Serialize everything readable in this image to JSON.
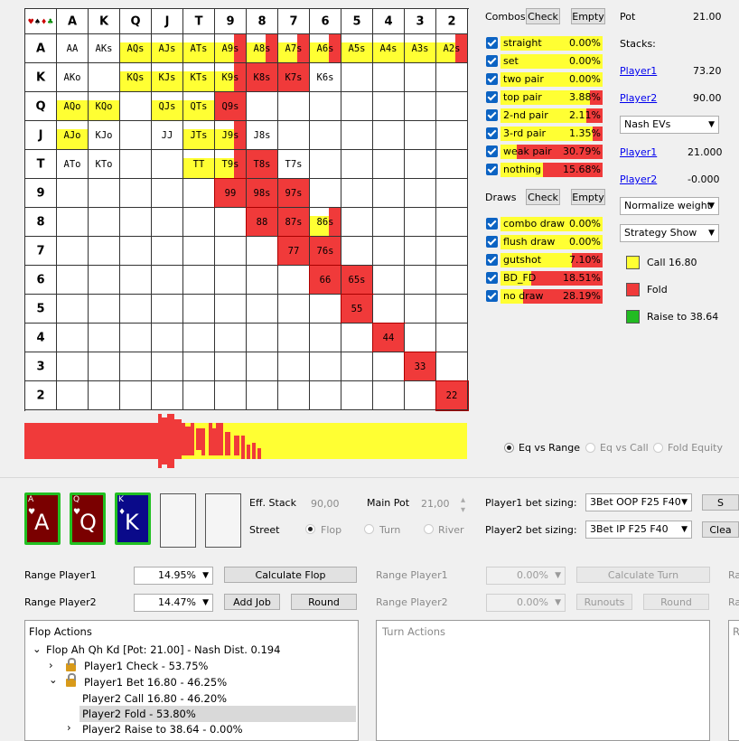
{
  "matrix": {
    "headers": [
      "A",
      "K",
      "Q",
      "J",
      "T",
      "9",
      "8",
      "7",
      "6",
      "5",
      "4",
      "3",
      "2"
    ],
    "corner_suits": [
      "♥",
      "♠",
      "♦",
      "♣"
    ],
    "cells": [
      {
        "r": 0,
        "c": 0,
        "label": "AA",
        "color": "none"
      },
      {
        "r": 0,
        "c": 1,
        "label": "AKs",
        "color": "none"
      },
      {
        "r": 0,
        "c": 2,
        "label": "AQs",
        "color": "yellow"
      },
      {
        "r": 0,
        "c": 3,
        "label": "AJs",
        "color": "yellow"
      },
      {
        "r": 0,
        "c": 4,
        "label": "ATs",
        "color": "yellow"
      },
      {
        "r": 0,
        "c": 5,
        "label": "A9s",
        "color": "mixed"
      },
      {
        "r": 0,
        "c": 6,
        "label": "A8s",
        "color": "mixed"
      },
      {
        "r": 0,
        "c": 7,
        "label": "A7s",
        "color": "mixed"
      },
      {
        "r": 0,
        "c": 8,
        "label": "A6s",
        "color": "mixed"
      },
      {
        "r": 0,
        "c": 9,
        "label": "A5s",
        "color": "yellow"
      },
      {
        "r": 0,
        "c": 10,
        "label": "A4s",
        "color": "yellow"
      },
      {
        "r": 0,
        "c": 11,
        "label": "A3s",
        "color": "yellow"
      },
      {
        "r": 0,
        "c": 12,
        "label": "A2s",
        "color": "mixed"
      },
      {
        "r": 1,
        "c": 0,
        "label": "AKo",
        "color": "none"
      },
      {
        "r": 1,
        "c": 2,
        "label": "KQs",
        "color": "yellow"
      },
      {
        "r": 1,
        "c": 3,
        "label": "KJs",
        "color": "yellow"
      },
      {
        "r": 1,
        "c": 4,
        "label": "KTs",
        "color": "yellow"
      },
      {
        "r": 1,
        "c": 5,
        "label": "K9s",
        "color": "mixed"
      },
      {
        "r": 1,
        "c": 6,
        "label": "K8s",
        "color": "red"
      },
      {
        "r": 1,
        "c": 7,
        "label": "K7s",
        "color": "red"
      },
      {
        "r": 1,
        "c": 8,
        "label": "K6s",
        "color": "none"
      },
      {
        "r": 2,
        "c": 0,
        "label": "AQo",
        "color": "yellow"
      },
      {
        "r": 2,
        "c": 1,
        "label": "KQo",
        "color": "yellow"
      },
      {
        "r": 2,
        "c": 3,
        "label": "QJs",
        "color": "yellow"
      },
      {
        "r": 2,
        "c": 4,
        "label": "QTs",
        "color": "yellow"
      },
      {
        "r": 2,
        "c": 5,
        "label": "Q9s",
        "color": "red"
      },
      {
        "r": 3,
        "c": 0,
        "label": "AJo",
        "color": "yellow"
      },
      {
        "r": 3,
        "c": 1,
        "label": "KJo",
        "color": "none"
      },
      {
        "r": 3,
        "c": 3,
        "label": "JJ",
        "color": "none"
      },
      {
        "r": 3,
        "c": 4,
        "label": "JTs",
        "color": "yellow"
      },
      {
        "r": 3,
        "c": 5,
        "label": "J9s",
        "color": "mixed"
      },
      {
        "r": 3,
        "c": 6,
        "label": "J8s",
        "color": "none"
      },
      {
        "r": 4,
        "c": 0,
        "label": "ATo",
        "color": "none"
      },
      {
        "r": 4,
        "c": 1,
        "label": "KTo",
        "color": "none"
      },
      {
        "r": 4,
        "c": 4,
        "label": "TT",
        "color": "yellow"
      },
      {
        "r": 4,
        "c": 5,
        "label": "T9s",
        "color": "mixed"
      },
      {
        "r": 4,
        "c": 6,
        "label": "T8s",
        "color": "red"
      },
      {
        "r": 4,
        "c": 7,
        "label": "T7s",
        "color": "none"
      },
      {
        "r": 5,
        "c": 5,
        "label": "99",
        "color": "red"
      },
      {
        "r": 5,
        "c": 6,
        "label": "98s",
        "color": "red"
      },
      {
        "r": 5,
        "c": 7,
        "label": "97s",
        "color": "red"
      },
      {
        "r": 6,
        "c": 6,
        "label": "88",
        "color": "red"
      },
      {
        "r": 6,
        "c": 7,
        "label": "87s",
        "color": "red"
      },
      {
        "r": 6,
        "c": 8,
        "label": "86s",
        "color": "mixed"
      },
      {
        "r": 7,
        "c": 7,
        "label": "77",
        "color": "red"
      },
      {
        "r": 7,
        "c": 8,
        "label": "76s",
        "color": "red"
      },
      {
        "r": 8,
        "c": 8,
        "label": "66",
        "color": "red"
      },
      {
        "r": 8,
        "c": 9,
        "label": "65s",
        "color": "red"
      },
      {
        "r": 9,
        "c": 9,
        "label": "55",
        "color": "red"
      },
      {
        "r": 10,
        "c": 10,
        "label": "44",
        "color": "red"
      },
      {
        "r": 11,
        "c": 11,
        "label": "33",
        "color": "red"
      },
      {
        "r": 12,
        "c": 12,
        "label": "22",
        "color": "red"
      }
    ]
  },
  "combos": {
    "title": "Combos",
    "check_label": "Check",
    "empty_label": "Empty",
    "items": [
      {
        "label": "straight",
        "pct": "0.00%",
        "red_fraction": 0.0
      },
      {
        "label": "set",
        "pct": "0.00%",
        "red_fraction": 0.0
      },
      {
        "label": "two pair",
        "pct": "0.00%",
        "red_fraction": 0.0
      },
      {
        "label": "top pair",
        "pct": "3.88%",
        "red_fraction": 0.12
      },
      {
        "label": "2-nd pair",
        "pct": "2.11%",
        "red_fraction": 0.16
      },
      {
        "label": "3-rd pair",
        "pct": "1.35%",
        "red_fraction": 0.1
      },
      {
        "label": "weak pair",
        "pct": "30.79%",
        "red_fraction": 0.84
      },
      {
        "label": "nothing",
        "pct": "15.68%",
        "red_fraction": 0.58
      }
    ]
  },
  "draws": {
    "title": "Draws",
    "check_label": "Check",
    "empty_label": "Empty",
    "items": [
      {
        "label": "combo draw",
        "pct": "0.00%",
        "red_fraction": 0.0
      },
      {
        "label": "flush draw",
        "pct": "0.00%",
        "red_fraction": 0.0
      },
      {
        "label": "gutshot",
        "pct": "7.10%",
        "red_fraction": 0.3
      },
      {
        "label": "BD_FD",
        "pct": "18.51%",
        "red_fraction": 0.7
      },
      {
        "label": "no draw",
        "pct": "28.19%",
        "red_fraction": 0.78
      }
    ]
  },
  "pot": {
    "label": "Pot",
    "value": "21.00"
  },
  "stacks": {
    "label": "Stacks:",
    "players": [
      {
        "name": "Player1",
        "value": "73.20"
      },
      {
        "name": "Player2",
        "value": "90.00"
      }
    ]
  },
  "ev_select": "Nash EVs",
  "evs": [
    {
      "name": "Player1",
      "value": "21.000"
    },
    {
      "name": "Player2",
      "value": "-0.000"
    }
  ],
  "normalize_select": "Normalize weight",
  "strategy_select": "Strategy Show",
  "legend": [
    {
      "label": "Call 16.80",
      "color": "#ffff33"
    },
    {
      "label": "Fold",
      "color": "#f03a3a"
    },
    {
      "label": "Raise to 38.64",
      "color": "#22bb22"
    }
  ],
  "eq_options": [
    {
      "label": "Eq vs Range",
      "selected": true,
      "enabled": true
    },
    {
      "label": "Eq vs Call",
      "selected": false,
      "enabled": false
    },
    {
      "label": "Fold Equity",
      "selected": false,
      "enabled": false
    }
  ],
  "board_cards": [
    {
      "rank": "A",
      "suit": "♥",
      "color": "#7a0000"
    },
    {
      "rank": "Q",
      "suit": "♥",
      "color": "#7a0000"
    },
    {
      "rank": "K",
      "suit": "♦",
      "color": "#0a0a8a"
    }
  ],
  "eff_stack": {
    "label": "Eff. Stack",
    "value": "90,00"
  },
  "main_pot": {
    "label": "Main Pot",
    "value": "21,00"
  },
  "street": {
    "label": "Street",
    "options": [
      "Flop",
      "Turn",
      "River"
    ]
  },
  "bet_sizing": [
    {
      "label": "Player1 bet sizing:",
      "value": "3Bet OOP F25 F40",
      "button": "S"
    },
    {
      "label": "Player2 bet sizing:",
      "value": "3Bet IP F25 F40",
      "button": "Clea"
    }
  ],
  "ranges": [
    {
      "label": "Range Player1",
      "value": "14.95%",
      "button": "Calculate Flop"
    },
    {
      "label": "Range Player2",
      "value": "14.47%",
      "button": "Add Job",
      "button2": "Round"
    }
  ],
  "turn_controls": {
    "range1_label": "Range Player1",
    "range1_value": "0.00%",
    "calc_label": "Calculate Turn",
    "range2_label": "Range Player2",
    "range2_value": "0.00%",
    "runouts_label": "Runouts",
    "round_label": "Round",
    "cut_label": "Ra"
  },
  "flop_actions": {
    "title": "Flop Actions",
    "root": "Flop Ah Qh Kd [Pot: 21.00] - Nash Dist. 0.194",
    "items": [
      {
        "text": "Player1 Check - 53.75%"
      },
      {
        "text": "Player1 Bet 16.80 - 46.25%"
      },
      {
        "text": "Player2 Call 16.80 - 46.20%"
      },
      {
        "text": "Player2 Fold - 53.80%"
      },
      {
        "text": "Player2 Raise to 38.64 - 0.00%"
      }
    ]
  },
  "turn_actions": {
    "title": "Turn Actions"
  },
  "river_actions": {
    "title": "R"
  }
}
